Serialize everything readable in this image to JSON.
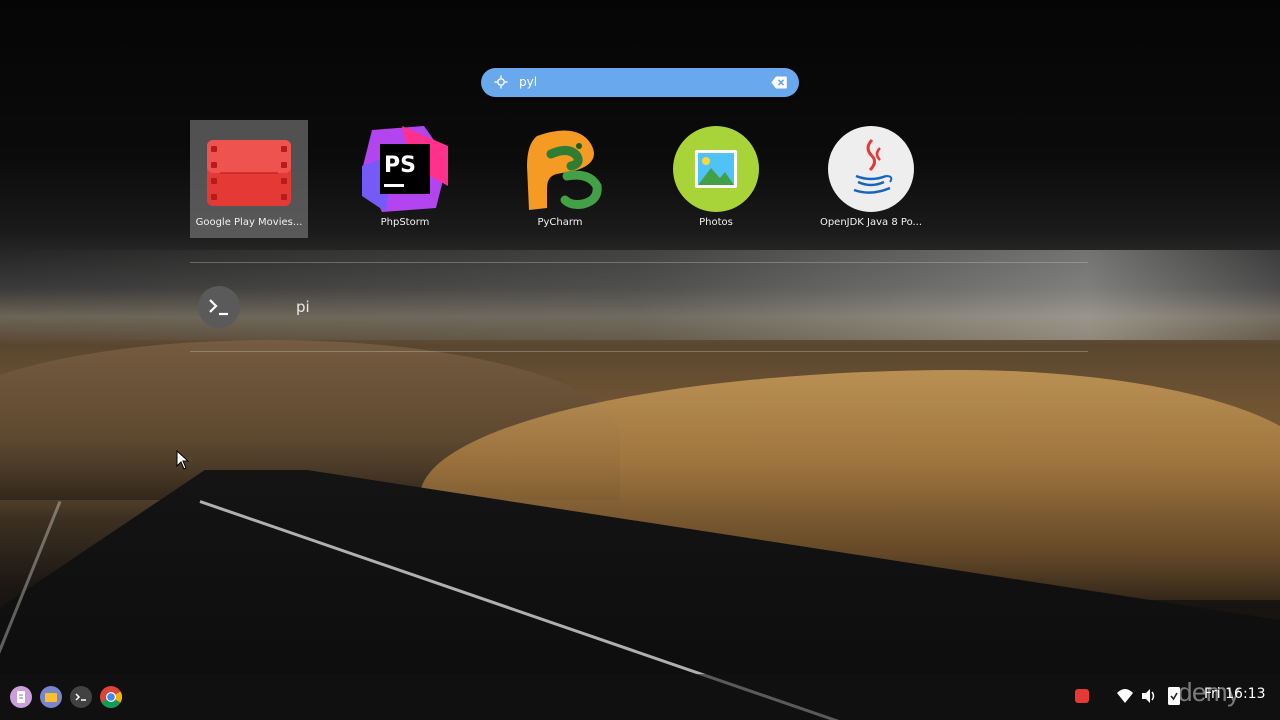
{
  "search": {
    "value": "pyl",
    "placeholder": ""
  },
  "apps": [
    {
      "label": "Google Play Movies...",
      "icon": "play-movies-icon",
      "selected": true
    },
    {
      "label": "PhpStorm",
      "icon": "phpstorm-icon",
      "selected": false
    },
    {
      "label": "PyCharm",
      "icon": "pycharm-icon",
      "selected": false
    },
    {
      "label": "Photos",
      "icon": "photos-icon",
      "selected": false
    },
    {
      "label": "OpenJDK Java 8 Po...",
      "icon": "java-icon",
      "selected": false
    }
  ],
  "omnibox_result": {
    "icon": "terminal-icon",
    "text": "pi"
  },
  "shelf": {
    "apps": [
      "app-launcher-icon",
      "files-icon",
      "terminal-icon",
      "chrome-icon"
    ]
  },
  "status": {
    "time": "Fri 16:13",
    "icons": [
      "record-icon",
      "wifi-icon",
      "volume-icon",
      "battery-icon"
    ]
  },
  "watermark": "demy",
  "colors": {
    "search_bg": "#6aa8ee",
    "play_movies_red": "#e53935",
    "photos_green": "#a8d43a"
  }
}
